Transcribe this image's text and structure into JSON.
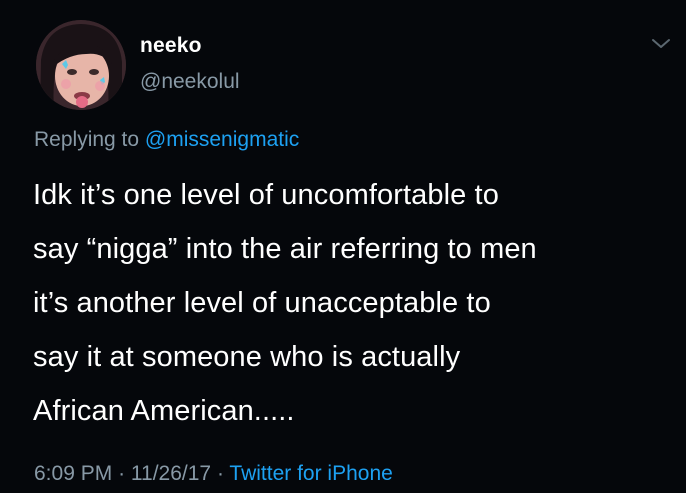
{
  "tweet": {
    "author": {
      "name": "neeko",
      "handle": "@neekolul",
      "avatar_icon": "profile-photo"
    },
    "more_icon": "chevron-down-icon",
    "reply": {
      "prefix": "Replying to",
      "mention": "@missenigmatic"
    },
    "text_lines": [
      "Idk it’s one level of uncomfortable to",
      "say “nigga” into the air referring to men",
      "it’s another level of unacceptable to",
      "say it at someone who is actually",
      "African American....."
    ],
    "meta": {
      "time": "6:09 PM",
      "date": "11/26/17",
      "separator": "·",
      "source": "Twitter for iPhone"
    }
  },
  "colors": {
    "background": "#05070b",
    "text": "#ffffff",
    "secondary": "#8899a6",
    "link": "#1da1f2"
  }
}
